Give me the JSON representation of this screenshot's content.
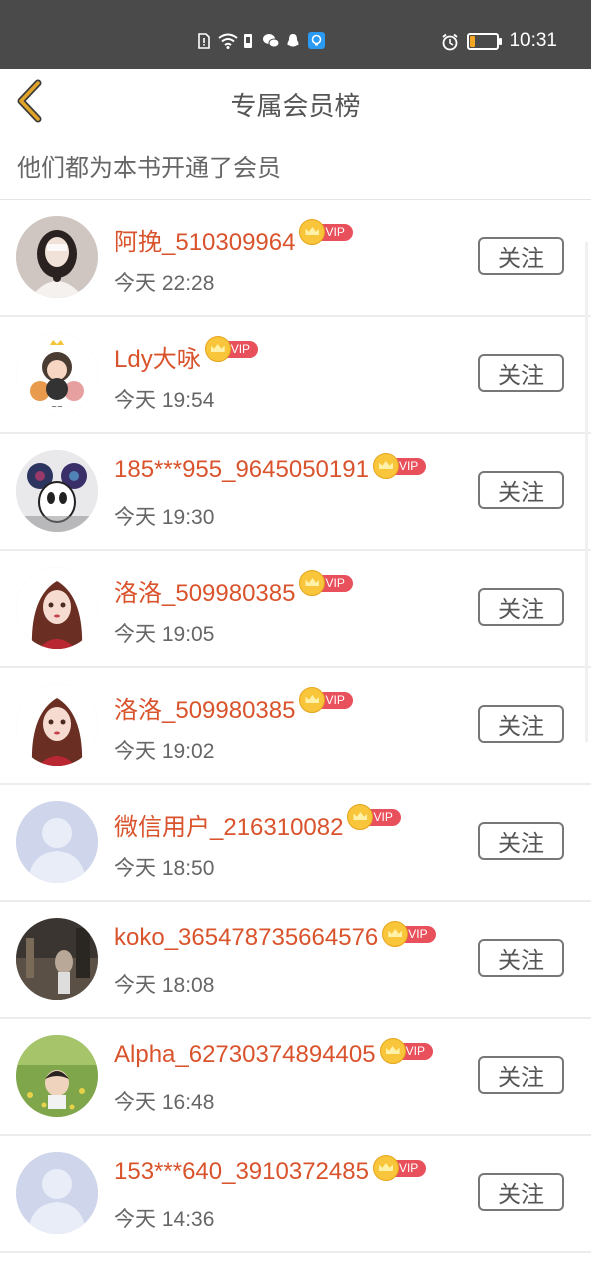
{
  "status_bar": {
    "time": "10:31",
    "battery_level": 0.2,
    "icons": [
      "alert-icon",
      "wifi-icon",
      "sim-icon",
      "wechat-icon",
      "qq-icon",
      "notification-app-icon",
      "alarm-icon",
      "battery-icon"
    ]
  },
  "header": {
    "title": "专属会员榜",
    "back_icon": "chevron-left-icon"
  },
  "subtitle": "他们都为本书开通了会员",
  "vip_label": "VIP",
  "follow_label": "关注",
  "colors": {
    "name": "#d9532c",
    "vip_badge": "#e8505b",
    "back_arrow": "#e0a42a",
    "status_bar": "#4a4a4a"
  },
  "members": [
    {
      "name": "阿挽_510309964",
      "time": "今天 22:28",
      "avatar": "girl-photo"
    },
    {
      "name": "Ldy大咏",
      "time": "今天 19:54",
      "avatar": "cartoon"
    },
    {
      "name": "185***955_9645050191",
      "time": "今天 19:30",
      "avatar": "mickey"
    },
    {
      "name": "洛洛_509980385",
      "time": "今天 19:05",
      "avatar": "anime-girl"
    },
    {
      "name": "洛洛_509980385",
      "time": "今天 19:02",
      "avatar": "anime-girl"
    },
    {
      "name": "微信用户_216310082",
      "time": "今天 18:50",
      "avatar": "default"
    },
    {
      "name": "koko_365478735664576",
      "time": "今天 18:08",
      "avatar": "dark-photo"
    },
    {
      "name": "Alpha_62730374894405",
      "time": "今天 16:48",
      "avatar": "grass-photo"
    },
    {
      "name": "153***640_3910372485",
      "time": "今天 14:36",
      "avatar": "default"
    }
  ]
}
